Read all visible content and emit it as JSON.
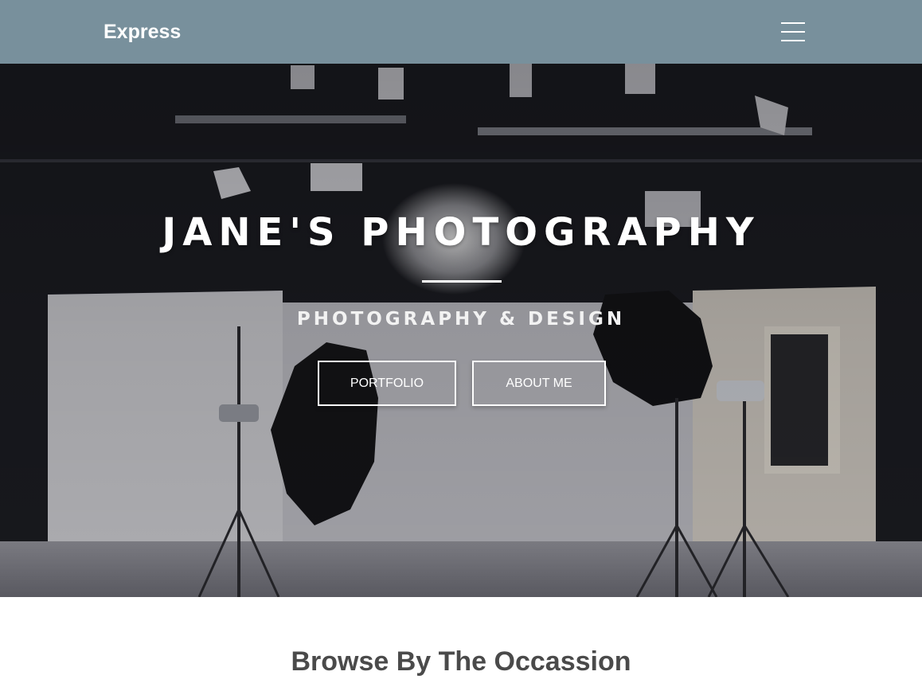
{
  "navbar": {
    "brand": "Express",
    "menu_icon": "hamburger-menu-icon",
    "background_color": "#78909c"
  },
  "hero": {
    "title": "JANE'S PHOTOGRAPHY",
    "subtitle": "PHOTOGRAPHY & DESIGN",
    "buttons": [
      {
        "label": "PORTFOLIO"
      },
      {
        "label": "ABOUT ME"
      }
    ],
    "background_image": "photo-studio-with-softbox-lights"
  },
  "section": {
    "heading": "Browse By The Occassion"
  }
}
